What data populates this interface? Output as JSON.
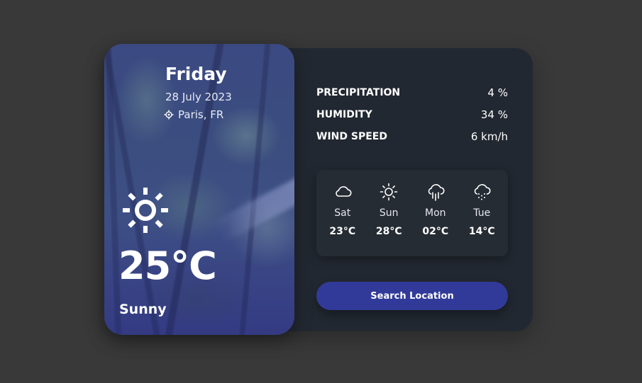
{
  "hero": {
    "day": "Friday",
    "date": "28 July 2023",
    "location": "Paris, FR",
    "location_icon": "location-crosshair-icon",
    "weather_icon": "sun-icon",
    "temperature": "25°C",
    "condition": "Sunny"
  },
  "stats": [
    {
      "label": "PRECIPITATION",
      "value": "4 %"
    },
    {
      "label": "HUMIDITY",
      "value": "34 %"
    },
    {
      "label": "WIND SPEED",
      "value": "6 km/h"
    }
  ],
  "forecast": [
    {
      "day": "Sat",
      "temp": "23°C",
      "icon": "cloud-icon"
    },
    {
      "day": "Sun",
      "temp": "28°C",
      "icon": "sun-icon"
    },
    {
      "day": "Mon",
      "temp": "02°C",
      "icon": "cloud-rain-icon"
    },
    {
      "day": "Tue",
      "temp": "14°C",
      "icon": "cloud-drizzle-icon"
    }
  ],
  "search_button": {
    "label": "Search Location"
  },
  "colors": {
    "background": "#393939",
    "card": "#222831",
    "forecast_panel": "#262c34",
    "button": "#323a99",
    "text": "#ffffff"
  }
}
